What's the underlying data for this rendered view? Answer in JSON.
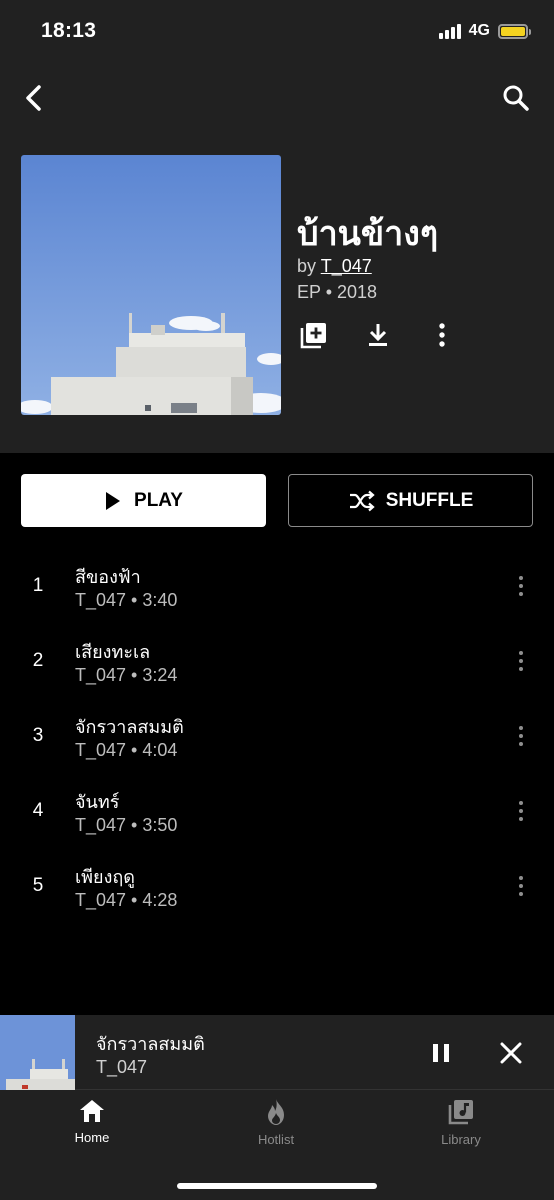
{
  "status_bar": {
    "time": "18:13",
    "network": "4G",
    "battery_color": "#f4d321"
  },
  "header": {
    "back_icon": "chevron-left-icon",
    "search_icon": "search-icon"
  },
  "album": {
    "title": "บ้านข้างๆ",
    "by_prefix": "by",
    "artist": "T_047",
    "type_year": "EP • 2018",
    "actions": {
      "add_icon": "add-to-library-icon",
      "download_icon": "download-icon",
      "more_icon": "more-vert-icon"
    }
  },
  "controls": {
    "play_label": "PLAY",
    "shuffle_label": "SHUFFLE"
  },
  "tracks": [
    {
      "number": "1",
      "title": "สีของฟ้า",
      "subtitle": "T_047 • 3:40"
    },
    {
      "number": "2",
      "title": "เสียงทะเล",
      "subtitle": "T_047 • 3:24"
    },
    {
      "number": "3",
      "title": "จักรวาลสมมติ",
      "subtitle": "T_047 • 4:04"
    },
    {
      "number": "4",
      "title": "จันทร์",
      "subtitle": "T_047 • 3:50"
    },
    {
      "number": "5",
      "title": "เพียงฤดู",
      "subtitle": "T_047 • 4:28"
    }
  ],
  "mini_player": {
    "title": "จักรวาลสมมติ",
    "artist": "T_047"
  },
  "bottom_nav": {
    "items": [
      {
        "label": "Home",
        "icon": "home-icon",
        "active": true
      },
      {
        "label": "Hotlist",
        "icon": "flame-icon",
        "active": false
      },
      {
        "label": "Library",
        "icon": "library-music-icon",
        "active": false
      }
    ],
    "active_color": "#ffffff",
    "inactive_color": "#8a8a8a"
  }
}
